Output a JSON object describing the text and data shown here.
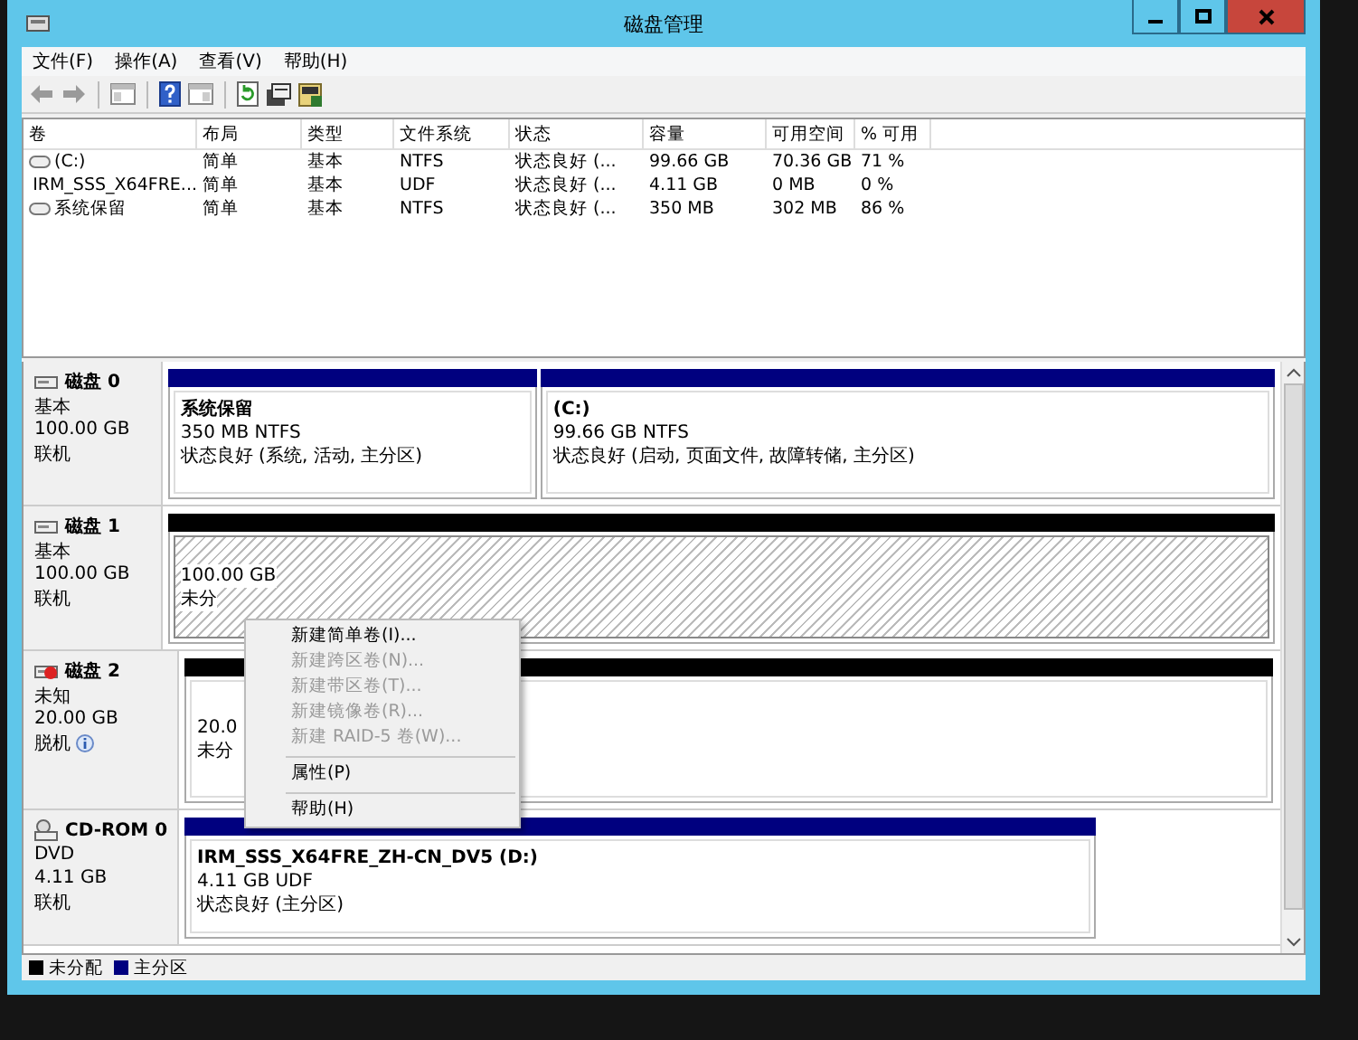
{
  "window": {
    "title": "磁盘管理"
  },
  "menu": [
    "文件(F)",
    "操作(A)",
    "查看(V)",
    "帮助(H)"
  ],
  "table": {
    "columns": [
      "卷",
      "布局",
      "类型",
      "文件系统",
      "状态",
      "容量",
      "可用空间",
      "% 可用"
    ],
    "rows": [
      {
        "kind": "drive",
        "cells": [
          "(C:)",
          "简单",
          "基本",
          "NTFS",
          "状态良好 (...",
          "99.66 GB",
          "70.36 GB",
          "71 %"
        ]
      },
      {
        "kind": "cdrom",
        "cells": [
          "IRM_SSS_X64FRE...",
          "简单",
          "基本",
          "UDF",
          "状态良好 (...",
          "4.11 GB",
          "0 MB",
          "0 %"
        ]
      },
      {
        "kind": "drive",
        "cells": [
          "系统保留",
          "简单",
          "基本",
          "NTFS",
          "状态良好 (...",
          "350 MB",
          "302 MB",
          "86 %"
        ]
      }
    ]
  },
  "disks": [
    {
      "kind": "drive",
      "name": "磁盘 0",
      "lines": [
        "基本",
        "100.00 GB",
        "联机"
      ],
      "offline": false,
      "partitions": [
        {
          "kind": "primary",
          "title": "系统保留",
          "lines": [
            "350 MB NTFS",
            "状态良好 (系统, 活动, 主分区)"
          ],
          "selected": false
        },
        {
          "kind": "primary",
          "title": "(C:)",
          "lines": [
            "99.66 GB NTFS",
            "状态良好 (启动, 页面文件, 故障转储, 主分区)"
          ],
          "selected": false
        }
      ]
    },
    {
      "kind": "drive",
      "name": "磁盘 1",
      "lines": [
        "基本",
        "100.00 GB",
        "联机"
      ],
      "offline": false,
      "partitions": [
        {
          "kind": "unallocated",
          "lines": [
            "100.00 GB",
            "未分"
          ],
          "selected": true
        }
      ]
    },
    {
      "kind": "drive",
      "name": "磁盘 2",
      "lines": [
        "未知",
        "20.00 GB",
        "脱机"
      ],
      "offline": true,
      "partitions": [
        {
          "kind": "unallocated",
          "lines": [
            "20.0",
            "未分"
          ],
          "selected": false
        }
      ]
    },
    {
      "kind": "cdrom",
      "name": "CD-ROM 0",
      "lines": [
        "DVD",
        "4.11 GB",
        "联机"
      ],
      "offline": false,
      "partitions": [
        {
          "kind": "primary",
          "title": "IRM_SSS_X64FRE_ZH-CN_DV5  (D:)",
          "lines": [
            "4.11 GB UDF",
            "状态良好 (主分区)"
          ],
          "selected": false
        }
      ]
    }
  ],
  "context_menu": [
    {
      "label": "新建简单卷(I)...",
      "disabled": false,
      "separator_before": false
    },
    {
      "label": "新建跨区卷(N)...",
      "disabled": true,
      "separator_before": false
    },
    {
      "label": "新建带区卷(T)...",
      "disabled": true,
      "separator_before": false
    },
    {
      "label": "新建镜像卷(R)...",
      "disabled": true,
      "separator_before": false
    },
    {
      "label": "新建 RAID-5 卷(W)...",
      "disabled": true,
      "separator_before": false
    },
    {
      "label": "属性(P)",
      "disabled": false,
      "separator_before": true
    },
    {
      "label": "帮助(H)",
      "disabled": false,
      "separator_before": true
    }
  ],
  "legend": [
    {
      "label": "未分配",
      "color": "#000000"
    },
    {
      "label": "主分区",
      "color": "#00007f"
    }
  ]
}
